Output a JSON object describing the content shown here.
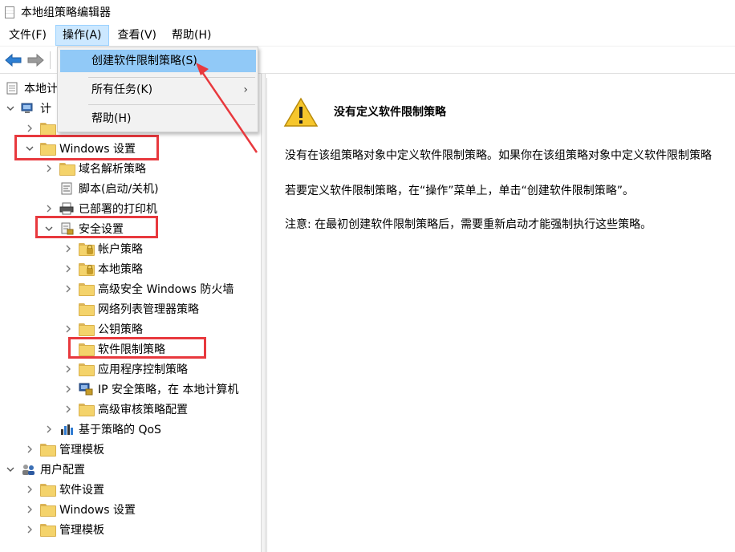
{
  "window": {
    "title": "本地组策略编辑器"
  },
  "menu": [
    {
      "label": "文件(F)",
      "active": false
    },
    {
      "label": "操作(A)",
      "active": true
    },
    {
      "label": "查看(V)",
      "active": false
    },
    {
      "label": "帮助(H)",
      "active": false
    }
  ],
  "dropdown": {
    "items": [
      {
        "label": "创建软件限制策略(S)",
        "highlight": true
      },
      {
        "label": "所有任务(K)",
        "submenu_arrow": "›"
      },
      {
        "label": "帮助(H)"
      }
    ]
  },
  "tree": {
    "root_label": "本地计",
    "computer_config_label": "计",
    "windows_settings": "Windows 设置",
    "dns_policy": "域名解析策略",
    "scripts": "脚本(启动/关机)",
    "printers": "已部署的打印机",
    "security_settings": "安全设置",
    "account_policy": "帐户策略",
    "local_policy": "本地策略",
    "firewall": "高级安全 Windows 防火墙",
    "netlist": "网络列表管理器策略",
    "pubkey": "公钥策略",
    "software_restriction": "软件限制策略",
    "applocker": "应用程序控制策略",
    "ipsec": "IP 安全策略，在 本地计算机",
    "audit": "高级审核策略配置",
    "qos": "基于策略的 QoS",
    "admin_templates": "管理模板",
    "user_config": "用户配置",
    "user_software": "软件设置",
    "user_windows": "Windows 设置",
    "user_admin_templates": "管理模板"
  },
  "detail": {
    "title": "没有定义软件限制策略",
    "line1": "没有在该组策略对象中定义软件限制策略。如果你在该组策略对象中定义软件限制策略",
    "line2": "若要定义软件限制策略，在“操作”菜单上，单击“创建软件限制策略”。",
    "line3": "注意: 在最初创建软件限制策略后，需要重新启动才能强制执行这些策略。"
  },
  "colors": {
    "highlight_box": "#e8393e",
    "menu_highlight": "#91c9f7",
    "menu_active": "#cce8ff",
    "folder": "#f4d36b"
  },
  "icons": {
    "back": "back-arrow-icon",
    "forward": "forward-arrow-icon",
    "warning": "warning-icon",
    "folder": "folder-icon"
  }
}
